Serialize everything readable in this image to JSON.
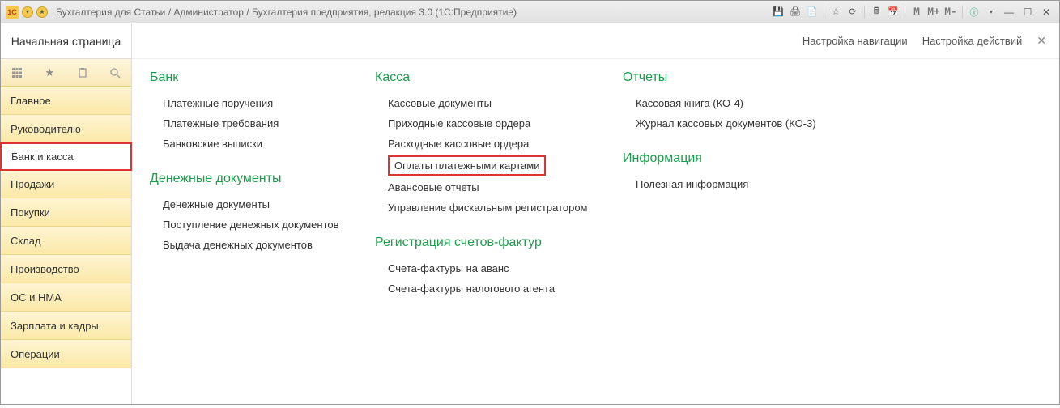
{
  "titlebar": {
    "text": "Бухгалтерия для Статьи / Администратор / Бухгалтерия предприятия, редакция 3.0  (1С:Предприятие)",
    "mm": {
      "m1": "M",
      "m2": "M+",
      "m3": "M-"
    }
  },
  "sidebar": {
    "home": "Начальная страница",
    "items": [
      "Главное",
      "Руководителю",
      "Банк и касса",
      "Продажи",
      "Покупки",
      "Склад",
      "Производство",
      "ОС и НМА",
      "Зарплата и кадры",
      "Операции"
    ]
  },
  "main_top": {
    "nav_setup": "Настройка навигации",
    "action_setup": "Настройка действий"
  },
  "columns": {
    "bank": {
      "title": "Банк",
      "links": [
        "Платежные поручения",
        "Платежные требования",
        "Банковские выписки"
      ]
    },
    "money_docs": {
      "title": "Денежные документы",
      "links": [
        "Денежные документы",
        "Поступление денежных документов",
        "Выдача денежных документов"
      ]
    },
    "kassa": {
      "title": "Касса",
      "links": [
        "Кассовые документы",
        "Приходные кассовые ордера",
        "Расходные кассовые ордера",
        "Оплаты платежными картами",
        "Авансовые отчеты",
        "Управление фискальным регистратором"
      ]
    },
    "invoice_reg": {
      "title": "Регистрация счетов-фактур",
      "links": [
        "Счета-фактуры на аванс",
        "Счета-фактуры налогового агента"
      ]
    },
    "reports": {
      "title": "Отчеты",
      "links": [
        "Кассовая книга (КО-4)",
        "Журнал кассовых документов (КО-3)"
      ]
    },
    "info": {
      "title": "Информация",
      "links": [
        "Полезная информация"
      ]
    }
  }
}
